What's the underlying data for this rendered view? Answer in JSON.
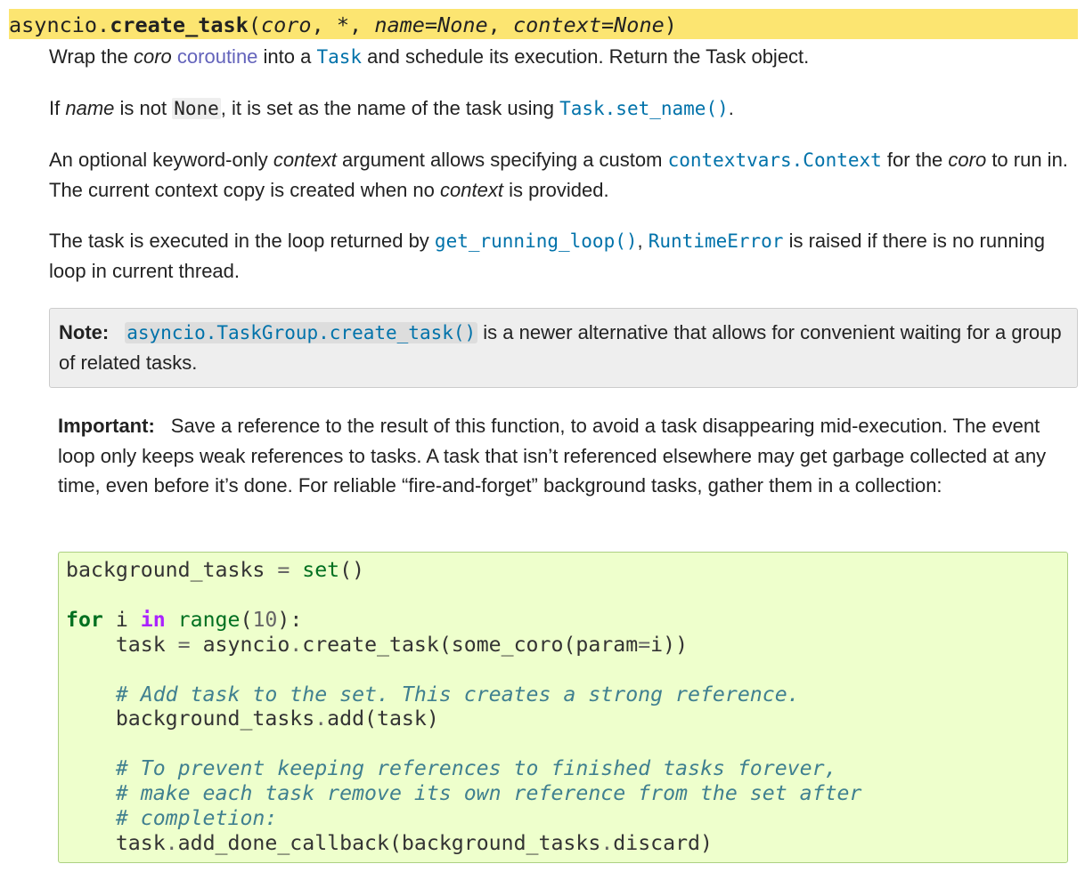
{
  "signature": {
    "module": "asyncio.",
    "name": "create_task",
    "open": "(",
    "param1": "coro",
    "sep1": ", ",
    "star": "*",
    "sep2": ", ",
    "param2": "name=None",
    "sep3": ", ",
    "param3": "context=None",
    "close": ")"
  },
  "para1": {
    "t1": "Wrap the ",
    "em1": "coro",
    "link1": "coroutine",
    "t2": " into a ",
    "link2": "Task",
    "t3": " and schedule its execution. Return the Task object."
  },
  "para2": {
    "t1": "If ",
    "em1": "name",
    "t2": " is not ",
    "code1": "None",
    "t3": ", it is set as the name of the task using ",
    "link1": "Task.set_name()",
    "t4": "."
  },
  "para3": {
    "t1": "An optional keyword-only ",
    "em1": "context",
    "t2": " argument allows specifying a custom ",
    "link1": "contextvars.Context",
    "t3": " for the ",
    "em2": "coro",
    "t4": " to run in. The current context copy is created when no ",
    "em3": "context",
    "t5": " is provided."
  },
  "para4": {
    "t1": "The task is executed in the loop returned by ",
    "link1": "get_running_loop()",
    "t2": ", ",
    "link2": "RuntimeError",
    "t3": " is raised if there is no running loop in current thread."
  },
  "note": {
    "label": "Note:",
    "link": "asyncio.TaskGroup.create_task()",
    "text": " is a newer alternative that allows for convenient waiting for a group of related tasks."
  },
  "important": {
    "label": "Important:",
    "text": "Save a reference to the result of this function, to avoid a task disappearing mid-execution. The event loop only keeps weak references to tasks. A task that isn’t referenced elsewhere may get garbage collected at any time, even before it’s done. For reliable “fire-and-forget” background tasks, gather them in a collection:"
  },
  "code": {
    "l1_a": "background_tasks ",
    "l1_op": "=",
    "l1_b": " ",
    "l1_bi": "set",
    "l1_c": "()",
    "l3_kw": "for",
    "l3_a": " i ",
    "l3_ow": "in",
    "l3_b": " ",
    "l3_bi": "range",
    "l3_c": "(",
    "l3_num": "10",
    "l3_d": "):",
    "l4_a": "    task ",
    "l4_op": "=",
    "l4_b": " asyncio",
    "l4_dot": ".",
    "l4_c": "create_task(some_coro(param",
    "l4_op2": "=",
    "l4_d": "i))",
    "l6_cm": "    # Add task to the set. This creates a strong reference.",
    "l7_a": "    background_tasks",
    "l7_dot": ".",
    "l7_b": "add(task)",
    "l9_cm": "    # To prevent keeping references to finished tasks forever,",
    "l10_cm": "    # make each task remove its own reference from the set after",
    "l11_cm": "    # completion:",
    "l12_a": "    task",
    "l12_dot": ".",
    "l12_b": "add_done_callback(background_tasks",
    "l12_dot2": ".",
    "l12_c": "discard)"
  },
  "colors": {
    "signature_bg": "#fce571",
    "link": "#0072aa",
    "visited_link": "#6363bb",
    "note_bg": "#eeeeee",
    "code_bg": "#eeffcc"
  }
}
